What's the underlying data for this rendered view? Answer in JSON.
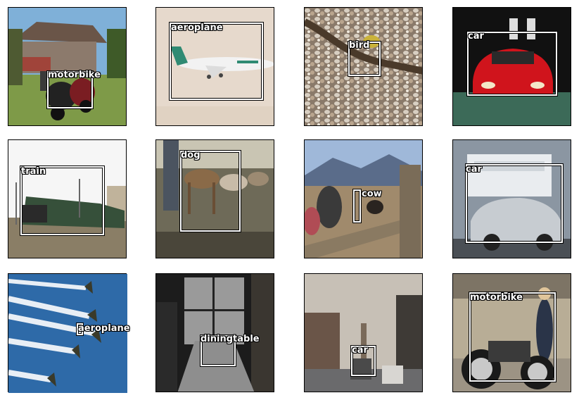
{
  "grid": {
    "panels": [
      {
        "label": "motorbike",
        "scene": "house-lawn"
      },
      {
        "label": "aeroplane",
        "scene": "plane-studio"
      },
      {
        "label": "bird",
        "scene": "gravel"
      },
      {
        "label": "car",
        "scene": "red-car"
      },
      {
        "label": "train",
        "scene": "train"
      },
      {
        "label": "dog",
        "scene": "dogs"
      },
      {
        "label": "cow",
        "scene": "field"
      },
      {
        "label": "car",
        "scene": "car-show"
      },
      {
        "label": "aeroplane",
        "scene": "sky-jets"
      },
      {
        "label": "diningtable",
        "scene": "dining-room"
      },
      {
        "label": "car",
        "scene": "street"
      },
      {
        "label": "motorbike",
        "scene": "garage-bike"
      }
    ]
  }
}
